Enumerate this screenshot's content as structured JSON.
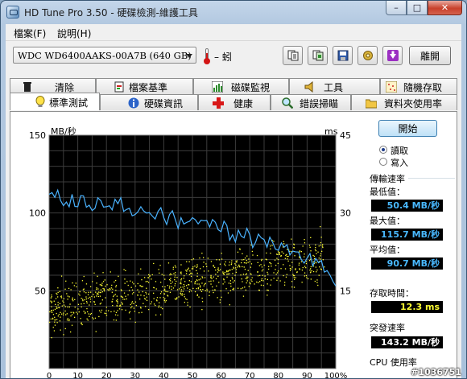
{
  "window": {
    "title": "HD Tune Pro 3.50 - 硬碟檢測-維護工具",
    "buttons": {
      "minimize": "–",
      "maximize": "□",
      "close": "✕"
    }
  },
  "menu": [
    {
      "label": "檔案(F)"
    },
    {
      "label": "說明(H)"
    }
  ],
  "toolbar": {
    "drive": "WDC WD6400AAKS-00A7B (640 GB)",
    "temperature": "– 蚓",
    "icons": [
      "copy-text-icon",
      "copy-screen-icon",
      "save-icon",
      "options-icon",
      "download-icon"
    ],
    "exit_label": "離開"
  },
  "tabs_top": [
    {
      "label": "清除",
      "icon": "trash-icon"
    },
    {
      "label": "檔案基準",
      "icon": "file-benchmark-icon"
    },
    {
      "label": "磁碟監視",
      "icon": "monitor-bars-icon"
    },
    {
      "label": "工具",
      "icon": "speaker-tool-icon"
    },
    {
      "label": "隨機存取",
      "icon": "random-access-icon"
    }
  ],
  "tabs_bottom": [
    {
      "label": "標準測試",
      "icon": "bulb-icon",
      "active": true
    },
    {
      "label": "硬碟資訊",
      "icon": "info-icon"
    },
    {
      "label": "健康",
      "icon": "health-cross-icon"
    },
    {
      "label": "錯誤掃瞄",
      "icon": "magnifier-icon"
    },
    {
      "label": "資料夾使用率",
      "icon": "folder-icon"
    }
  ],
  "side": {
    "start_label": "開始",
    "read_label": "讀取",
    "write_label": "寫入",
    "transfer_title": "傳輸速率",
    "min_label": "最低值：",
    "min_value": "50.4 MB/秒",
    "max_label": "最大值：",
    "max_value": "115.7 MB/秒",
    "avg_label": "平均值：",
    "avg_value": "90.7 MB/秒",
    "access_label": "存取時間：",
    "access_value": "12.3 ms",
    "burst_label": "突發速率",
    "burst_value": "143.2 MB/秒",
    "cpu_label": "CPU 使用率"
  },
  "watermark": "#1036751",
  "chart_data": {
    "type": "line",
    "y_label_left": "MB/秒",
    "y_label_right": "ms",
    "ylim_left": [
      0,
      150
    ],
    "ylim_right": [
      0,
      45
    ],
    "left_ticks": [
      "150",
      "100",
      "50"
    ],
    "left_tick_values": [
      150,
      100,
      50
    ],
    "right_ticks": [
      "45",
      "30",
      "15"
    ],
    "right_tick_values": [
      45,
      30,
      15
    ],
    "x_ticks": [
      "0",
      "10",
      "20",
      "30",
      "40",
      "50",
      "60",
      "70",
      "80",
      "90",
      "100%"
    ],
    "x_tick_values": [
      0,
      10,
      20,
      30,
      40,
      50,
      60,
      70,
      80,
      90,
      100
    ],
    "grid": true,
    "series": [
      {
        "color": "#4ab3ff",
        "x": [
          0,
          2,
          4,
          6,
          8,
          10,
          12,
          14,
          16,
          18,
          20,
          22,
          24,
          26,
          28,
          30,
          32,
          34,
          36,
          38,
          40,
          42,
          44,
          46,
          48,
          50,
          52,
          54,
          56,
          58,
          60,
          62,
          64,
          66,
          68,
          70,
          72,
          74,
          76,
          78,
          80,
          82,
          84,
          86,
          88,
          90,
          92,
          94,
          96,
          98,
          100
        ],
        "values": [
          112,
          110,
          108,
          107,
          112,
          104,
          111,
          105,
          103,
          108,
          104,
          102,
          106,
          101,
          103,
          99,
          104,
          100,
          98,
          101,
          97,
          99,
          96,
          97,
          94,
          97,
          93,
          95,
          91,
          94,
          88,
          92,
          86,
          89,
          84,
          86,
          81,
          84,
          78,
          81,
          76,
          78,
          73,
          75,
          70,
          71,
          66,
          68,
          62,
          60,
          53
        ]
      },
      {
        "color": "#ffff33",
        "x": [
          0,
          5,
          10,
          15,
          20,
          25,
          30,
          35,
          40,
          45,
          50,
          55,
          60,
          65,
          70,
          75,
          80,
          85,
          90,
          95,
          100
        ],
        "values": [
          11.5,
          12.1,
          12.6,
          13.2,
          13.7,
          14.2,
          14.7,
          15.3,
          15.8,
          16.3,
          16.9,
          17.4,
          17.9,
          18.4,
          18.9,
          19.5,
          20.1,
          20.6,
          21.1,
          21.6,
          22.1
        ],
        "spread": 3.2
      }
    ]
  }
}
